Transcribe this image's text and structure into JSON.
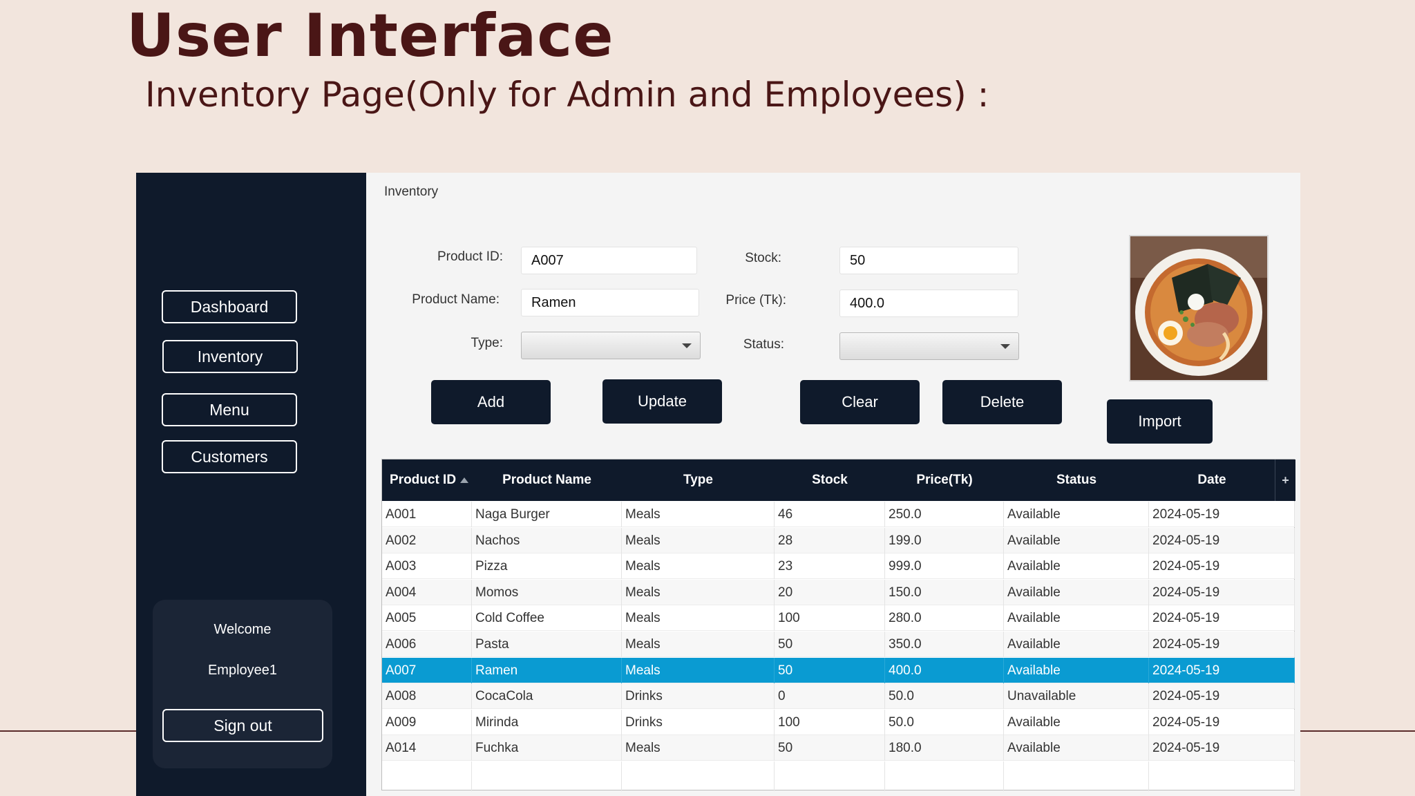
{
  "slide": {
    "title": "User Interface",
    "subtitle": "Inventory Page(Only for Admin and Employees) :"
  },
  "sidebar": {
    "items": [
      {
        "label": "Dashboard"
      },
      {
        "label": "Inventory"
      },
      {
        "label": "Menu"
      },
      {
        "label": "Customers"
      }
    ],
    "welcome": "Welcome",
    "username": "Employee1",
    "signout_label": "Sign out"
  },
  "main": {
    "breadcrumb": "Inventory",
    "form": {
      "product_id_label": "Product ID:",
      "product_id_value": "A007",
      "product_name_label": "Product Name:",
      "product_name_value": "Ramen",
      "type_label": "Type:",
      "type_value": "",
      "stock_label": "Stock:",
      "stock_value": "50",
      "price_label": "Price (Tk):",
      "price_value": "400.0",
      "status_label": "Status:",
      "status_value": ""
    },
    "buttons": {
      "add": "Add",
      "update": "Update",
      "clear": "Clear",
      "delete": "Delete",
      "import": "Import"
    },
    "image_icon": "ramen-bowl-image"
  },
  "table": {
    "columns": [
      "Product ID",
      "Product Name",
      "Type",
      "Stock",
      "Price(Tk)",
      "Status",
      "Date"
    ],
    "add_column_symbol": "+",
    "sorted_column": "Product ID",
    "rows": [
      [
        "A001",
        "Naga Burger",
        "Meals",
        "46",
        "250.0",
        "Available",
        "2024-05-19"
      ],
      [
        "A002",
        "Nachos",
        "Meals",
        "28",
        "199.0",
        "Available",
        "2024-05-19"
      ],
      [
        "A003",
        "Pizza",
        "Meals",
        "23",
        "999.0",
        "Available",
        "2024-05-19"
      ],
      [
        "A004",
        "Momos",
        "Meals",
        "20",
        "150.0",
        "Available",
        "2024-05-19"
      ],
      [
        "A005",
        "Cold Coffee",
        "Meals",
        "100",
        "280.0",
        "Available",
        "2024-05-19"
      ],
      [
        "A006",
        "Pasta",
        "Meals",
        "50",
        "350.0",
        "Available",
        "2024-05-19"
      ],
      [
        "A007",
        "Ramen",
        "Meals",
        "50",
        "400.0",
        "Available",
        "2024-05-19"
      ],
      [
        "A008",
        "CocaCola",
        "Drinks",
        "0",
        "50.0",
        "Unavailable",
        "2024-05-19"
      ],
      [
        "A009",
        "Mirinda",
        "Drinks",
        "100",
        "50.0",
        "Available",
        "2024-05-19"
      ],
      [
        "A014",
        "Fuchka",
        "Meals",
        "50",
        "180.0",
        "Available",
        "2024-05-19"
      ]
    ],
    "selected_row_index": 6,
    "selection_color": "#0a9bd2"
  },
  "colors": {
    "background": "#f2e5dd",
    "title": "#4a1616",
    "navy": "#0f1a2b",
    "accent": "#0a9bd2"
  }
}
